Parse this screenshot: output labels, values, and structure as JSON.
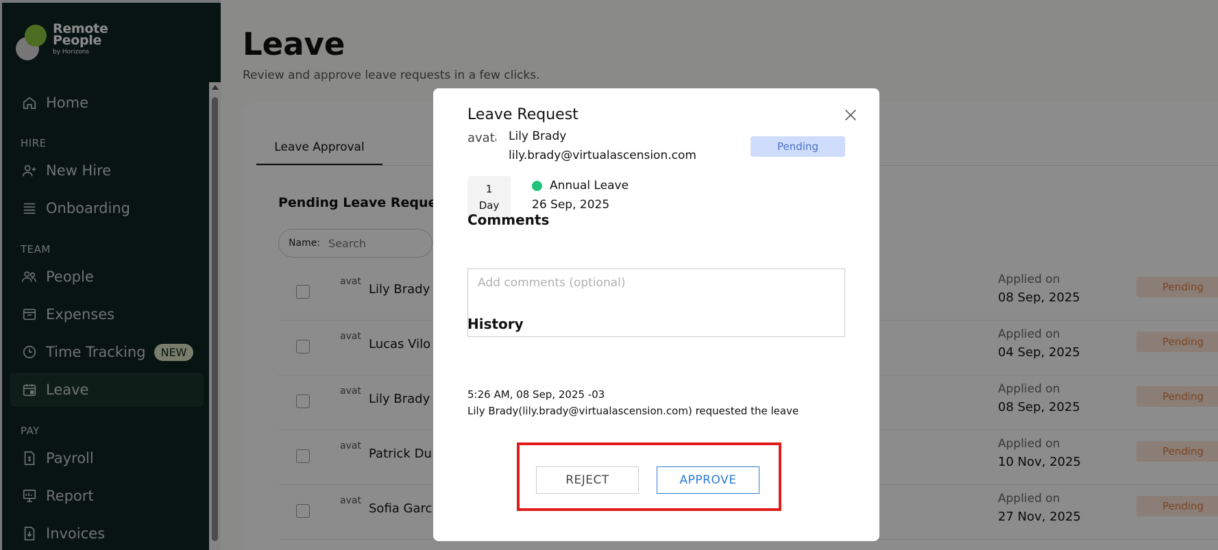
{
  "sidebar": {
    "brand": {
      "line1": "Remote",
      "line2": "People",
      "tagline": "by Horizons"
    },
    "items": [
      {
        "label": "Home",
        "icon": "home-icon"
      },
      {
        "label": "New Hire",
        "icon": "user-plus-icon"
      },
      {
        "label": "Onboarding",
        "icon": "list-icon"
      },
      {
        "label": "People",
        "icon": "users-icon"
      },
      {
        "label": "Expenses",
        "icon": "wallet-icon"
      },
      {
        "label": "Time Tracking",
        "icon": "clock-icon",
        "badge": "NEW"
      },
      {
        "label": "Leave",
        "icon": "calendar-icon",
        "active": true
      },
      {
        "label": "Payroll",
        "icon": "payroll-icon"
      },
      {
        "label": "Report",
        "icon": "report-icon"
      },
      {
        "label": "Invoices",
        "icon": "invoice-icon"
      }
    ],
    "sections": {
      "hire": "HIRE",
      "team": "TEAM",
      "pay": "PAY"
    }
  },
  "main": {
    "title": "Leave",
    "subtitle": "Review and approve leave requests in a few clicks.",
    "tab": "Leave Approval",
    "section_title": "Pending Leave Request",
    "search": {
      "label": "Name:",
      "placeholder": "Search"
    },
    "rows": [
      {
        "name": "Lily Brady",
        "applied_label": "Applied on",
        "applied_date": "08 Sep, 2025",
        "status": "Pending"
      },
      {
        "name": "Lucas Vilo",
        "applied_label": "Applied on",
        "applied_date": "04 Sep, 2025",
        "status": "Pending"
      },
      {
        "name": "Lily Brady",
        "applied_label": "Applied on",
        "applied_date": "08 Sep, 2025",
        "status": "Pending"
      },
      {
        "name": "Patrick Du",
        "applied_label": "Applied on",
        "applied_date": "10 Nov, 2025",
        "status": "Pending"
      },
      {
        "name": "Sofia Garc",
        "applied_label": "Applied on",
        "applied_date": "27 Nov, 2025",
        "status": "Pending"
      }
    ],
    "avatar_alt": "avat"
  },
  "modal": {
    "title": "Leave Request",
    "avatar_alt": "avatar",
    "name": "Lily Brady",
    "email": "lily.brady@virtualascension.com",
    "status": "Pending",
    "days_count": "1",
    "days_unit": "Day",
    "leave_type": "Annual Leave",
    "leave_date": "26 Sep, 2025",
    "comments_heading": "Comments",
    "comments_placeholder": "Add comments (optional)",
    "history_heading": "History",
    "history_time": "5:26 AM, 08 Sep, 2025 -03",
    "history_text": "Lily Brady(lily.brady@virtualascension.com) requested the leave",
    "reject_label": "REJECT",
    "approve_label": "APPROVE"
  },
  "colors": {
    "sidebar_bg": "#0e2620",
    "pending_modal_badge": "#cfdcfb",
    "pending_row_badge": "#fde6d8",
    "approve_blue": "#2a7bd6",
    "highlight_red": "#e01b1b",
    "leave_dot": "#22c37a"
  }
}
